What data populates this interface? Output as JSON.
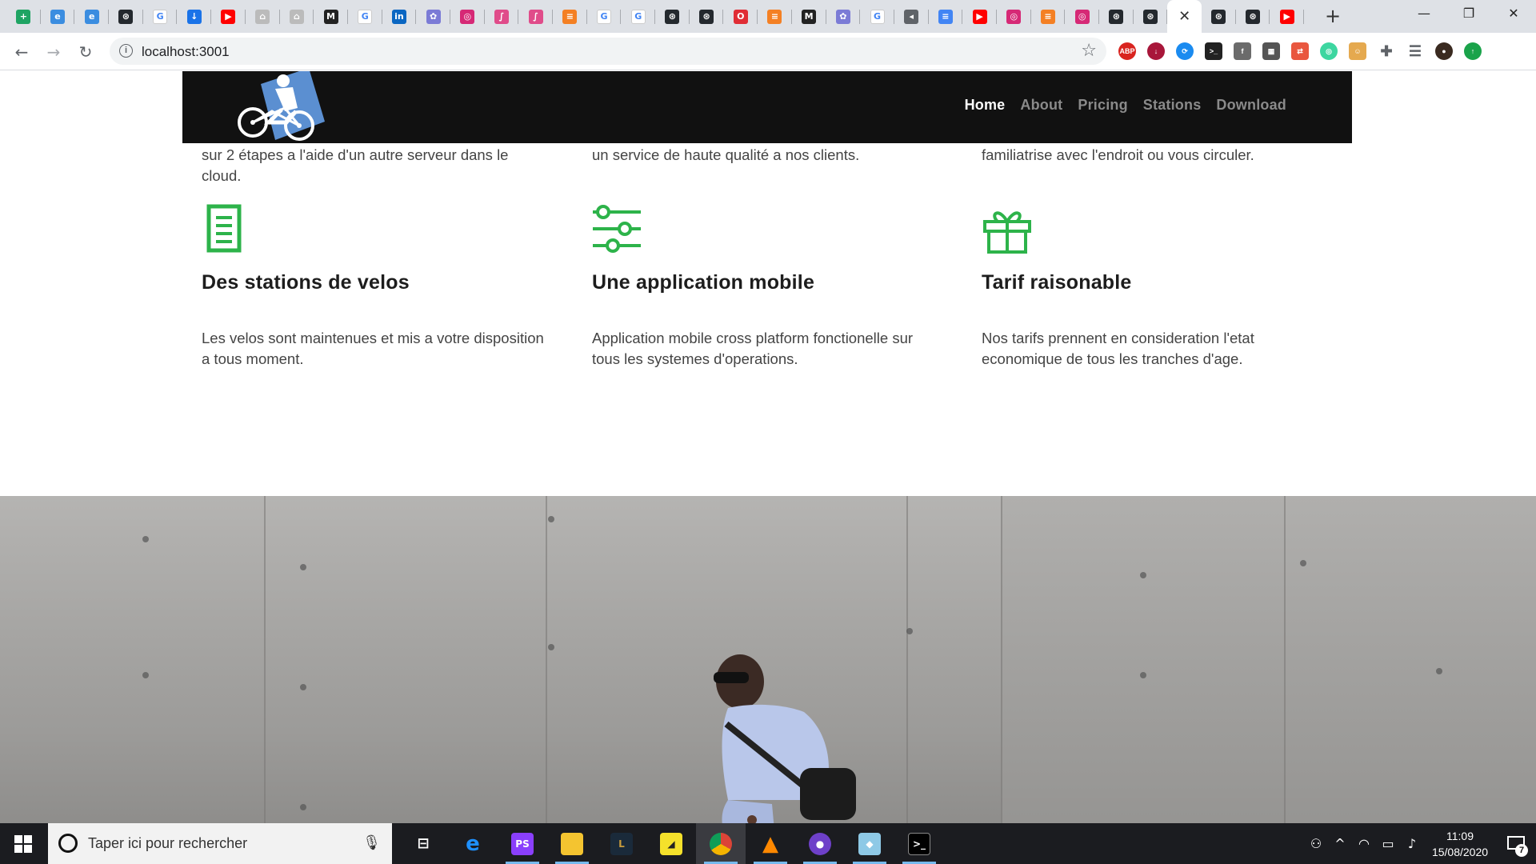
{
  "browser": {
    "tab_favicons": [
      "sheets",
      "edge",
      "edge",
      "github",
      "google",
      "download",
      "youtube",
      "airbnb",
      "airbnb",
      "medium",
      "google",
      "linkedin",
      "purple",
      "instagram",
      "pink",
      "pink",
      "stack",
      "google",
      "google",
      "github",
      "github",
      "opera",
      "stack",
      "medium",
      "purple",
      "google",
      "sound",
      "docs",
      "youtube",
      "instagram",
      "stack",
      "instagram",
      "github",
      "github",
      "active",
      "github",
      "github",
      "youtube-red"
    ],
    "tab_close": "✕",
    "new_tab": "+",
    "window": {
      "minimize": "—",
      "restore": "❐",
      "close": "✕"
    },
    "url": "localhost:3001",
    "nav": {
      "back": "←",
      "forward": "→",
      "reload": "↻"
    }
  },
  "site": {
    "nav": {
      "items": [
        {
          "label": "Home",
          "active": true
        },
        {
          "label": "About",
          "active": false
        },
        {
          "label": "Pricing",
          "active": false
        },
        {
          "label": "Stations",
          "active": false
        },
        {
          "label": "Download",
          "active": false
        }
      ]
    },
    "top_row": [
      {
        "line1": "sur 2 étapes a l'aide d'un autre serveur dans le",
        "line2": "cloud."
      },
      {
        "line1": "un service de haute qualité a nos clients.",
        "line2": ""
      },
      {
        "line1": "familiatrise avec l'endroit ou vous circuler.",
        "line2": ""
      }
    ],
    "features": [
      {
        "icon": "document-icon",
        "title": "Des stations de velos",
        "text1": "Les velos sont maintenues et mis a votre disposition",
        "text2": "a tous moment."
      },
      {
        "icon": "sliders-icon",
        "title": "Une application mobile",
        "text1": "Application mobile cross platform fonctionelle sur",
        "text2": "tous les systemes d'operations."
      },
      {
        "icon": "gift-icon",
        "title": "Tarif raisonable",
        "text1": "Nos tarifs prennent en consideration l'etat",
        "text2": "economique de tous les tranches d'age."
      }
    ],
    "accent_color": "#2db34a"
  },
  "taskbar": {
    "search_placeholder": "Taper ici pour rechercher",
    "time": "11:09",
    "date": "15/08/2020",
    "notification_count": "7"
  }
}
